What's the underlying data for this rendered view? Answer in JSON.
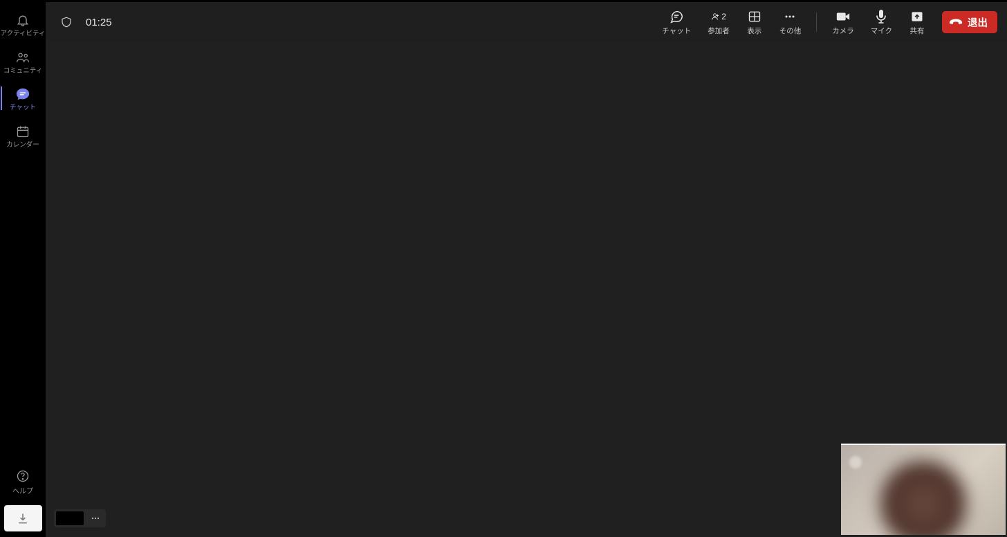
{
  "sidebar": {
    "items": [
      {
        "label": "アクティビティ"
      },
      {
        "label": "コミュニティ"
      },
      {
        "label": "チャット"
      },
      {
        "label": "カレンダー"
      }
    ],
    "help_label": "ヘルプ"
  },
  "toolbar": {
    "timer": "01:25",
    "participant_count": "2",
    "chat_label": "チャット",
    "people_label": "参加者",
    "view_label": "表示",
    "more_label": "その他",
    "camera_label": "カメラ",
    "mic_label": "マイク",
    "share_label": "共有",
    "leave_label": "退出"
  }
}
